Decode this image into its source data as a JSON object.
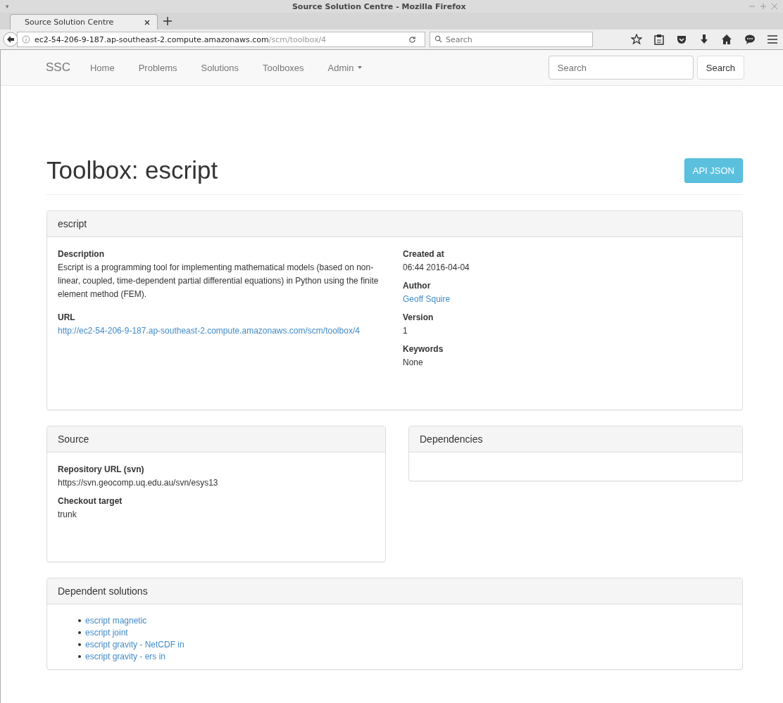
{
  "browser": {
    "window_menu": "▾",
    "window_title": "Source Solution Centre - Mozilla Firefox",
    "tab": {
      "label": "Source Solution Centre",
      "selected": true
    },
    "url_host": "ec2-54-206-9-187.ap-southeast-2.compute.amazonaws.com",
    "url_path": "/scm/toolbox/4",
    "search_placeholder": "Search"
  },
  "navbar": {
    "brand": "SSC",
    "items": [
      {
        "label": "Home",
        "dropdown": false
      },
      {
        "label": "Problems",
        "dropdown": false
      },
      {
        "label": "Solutions",
        "dropdown": false
      },
      {
        "label": "Toolboxes",
        "dropdown": false
      },
      {
        "label": "Admin",
        "dropdown": true
      }
    ],
    "search_placeholder": "Search",
    "search_button": "Search"
  },
  "page": {
    "title": "Toolbox: escript",
    "api_button": "API JSON"
  },
  "details": {
    "heading": "escript",
    "left": [
      {
        "label": "Description",
        "value": "Escript is a programming tool for implementing mathematical models (based on non-linear, coupled, time-dependent partial differential equations) in Python using the finite element method (FEM).",
        "kind": "text"
      },
      {
        "label": "URL",
        "value": "http://ec2-54-206-9-187.ap-southeast-2.compute.amazonaws.com/scm/toolbox/4",
        "kind": "link"
      }
    ],
    "right": [
      {
        "label": "Created at",
        "value": "06:44 2016-04-04",
        "kind": "text"
      },
      {
        "label": "Author",
        "value": "Geoff Squire",
        "kind": "link"
      },
      {
        "label": "Version",
        "value": "1",
        "kind": "text"
      },
      {
        "label": "Keywords",
        "value": "None",
        "kind": "text"
      }
    ]
  },
  "source": {
    "heading": "Source",
    "fields": [
      {
        "label": "Repository URL (svn)",
        "value": "https://svn.geocomp.uq.edu.au/svn/esys13"
      },
      {
        "label": "Checkout target",
        "value": "trunk"
      }
    ]
  },
  "dependencies": {
    "heading": "Dependencies"
  },
  "dependent_solutions": {
    "heading": "Dependent solutions",
    "items": [
      "escript magnetic",
      "escript joint",
      "escript gravity - NetCDF in",
      "escript gravity - ers in"
    ]
  }
}
